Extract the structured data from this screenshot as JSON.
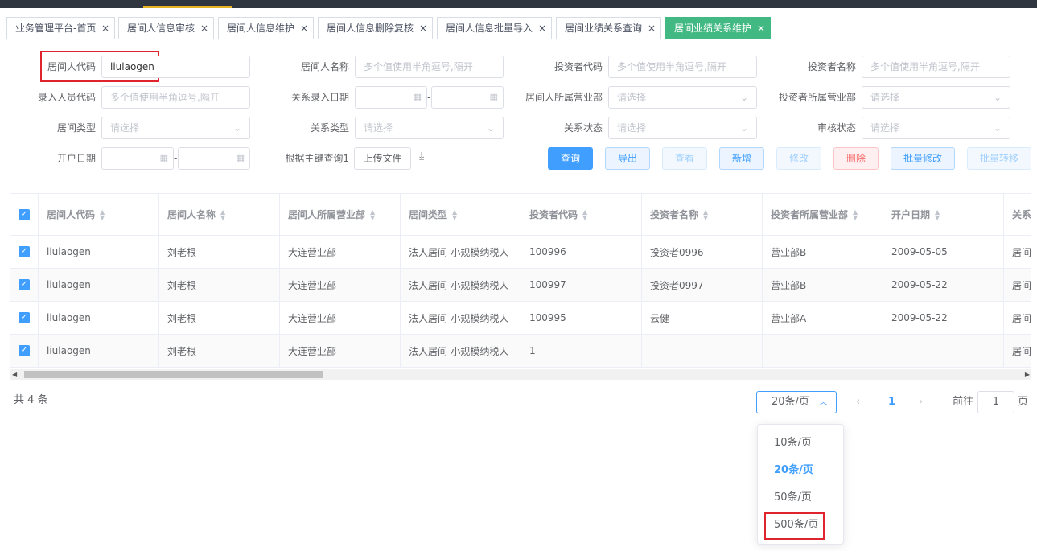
{
  "tabs": [
    {
      "label": "业务管理平台-首页"
    },
    {
      "label": "居间人信息审核"
    },
    {
      "label": "居间人信息维护"
    },
    {
      "label": "居间人信息删除复核"
    },
    {
      "label": "居间人信息批量导入"
    },
    {
      "label": "居间业绩关系查询"
    },
    {
      "label": "居间业绩关系维护"
    }
  ],
  "close_glyph": "×",
  "filters": {
    "broker_code": {
      "label": "居间人代码",
      "value": "liulaogen"
    },
    "broker_name": {
      "label": "居间人名称",
      "placeholder": "多个值使用半角逗号,隔开"
    },
    "investor_code": {
      "label": "投资者代码",
      "placeholder": "多个值使用半角逗号,隔开"
    },
    "investor_name": {
      "label": "投资者名称",
      "placeholder": "多个值使用半角逗号,隔开"
    },
    "entry_user_code": {
      "label": "录入人员代码",
      "placeholder": "多个值使用半角逗号,隔开"
    },
    "relation_date": {
      "label": "关系录入日期",
      "sep": "-"
    },
    "broker_dept": {
      "label": "居间人所属营业部",
      "placeholder": "请选择"
    },
    "investor_dept": {
      "label": "投资者所属营业部",
      "placeholder": "请选择"
    },
    "broker_type": {
      "label": "居间类型",
      "placeholder": "请选择"
    },
    "relation_type": {
      "label": "关系类型",
      "placeholder": "请选择"
    },
    "relation_status": {
      "label": "关系状态",
      "placeholder": "请选择"
    },
    "audit_status": {
      "label": "审核状态",
      "placeholder": "请选择"
    },
    "open_date": {
      "label": "开户日期",
      "sep": "-"
    },
    "key_query": {
      "label": "根据主键查询1",
      "upload": "上传文件"
    }
  },
  "buttons": {
    "query": "查询",
    "export": "导出",
    "view": "查看",
    "add": "新增",
    "edit": "修改",
    "delete": "删除",
    "batch_edit": "批量修改",
    "batch_transfer": "批量转移"
  },
  "table": {
    "columns": [
      "居间人代码",
      "居间人名称",
      "居间人所属营业部",
      "居间类型",
      "投资者代码",
      "投资者名称",
      "投资者所属营业部",
      "开户日期",
      "关系"
    ],
    "rows": [
      [
        "liulaogen",
        "刘老根",
        "大连营业部",
        "法人居间-小规模纳税人",
        "100996",
        "投资者0996",
        "营业部B",
        "2009-05-05",
        "居间"
      ],
      [
        "liulaogen",
        "刘老根",
        "大连营业部",
        "法人居间-小规模纳税人",
        "100997",
        "投资者0997",
        "营业部B",
        "2009-05-22",
        "居间"
      ],
      [
        "liulaogen",
        "刘老根",
        "大连营业部",
        "法人居间-小规模纳税人",
        "100995",
        "云健",
        "营业部A",
        "2009-05-22",
        "居间"
      ],
      [
        "liulaogen",
        "刘老根",
        "大连营业部",
        "法人居间-小规模纳税人",
        "1",
        "",
        "",
        "",
        "居间"
      ]
    ]
  },
  "pagination": {
    "total": "共 4 条",
    "page_size": "20条/页",
    "current_page": "1",
    "goto_label": "前往",
    "goto_value": "1",
    "page_unit": "页",
    "options": [
      "10条/页",
      "20条/页",
      "50条/页",
      "500条/页"
    ]
  },
  "colors": {
    "primary": "#409eff",
    "active_tab": "#42b983",
    "highlight_box": "#e0242e"
  }
}
